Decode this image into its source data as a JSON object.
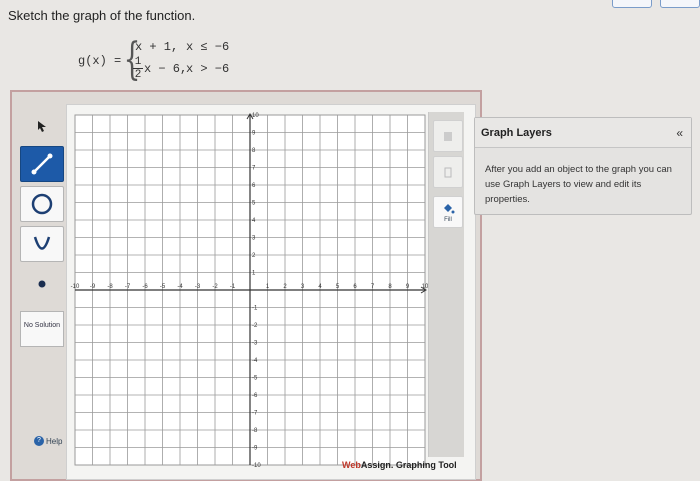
{
  "instruction": "Sketch the graph of the function.",
  "function": {
    "name": "g(x) =",
    "piece1_expr": "x + 1,",
    "piece1_cond": "x ≤ −6",
    "piece2_frac_num": "1",
    "piece2_frac_den": "2",
    "piece2_expr": "x − 6,",
    "piece2_cond": "x > −6"
  },
  "toolbar": {
    "no_solution_label": "No Solution",
    "help_label": "Help"
  },
  "graph": {
    "x_ticks": [
      "-10",
      "-9",
      "-8",
      "-7",
      "-6",
      "-5",
      "-4",
      "-3",
      "-2",
      "-1",
      "1",
      "2",
      "3",
      "4",
      "5",
      "6",
      "7",
      "8",
      "9",
      "10"
    ],
    "y_ticks": [
      "10",
      "9",
      "8",
      "7",
      "6",
      "5",
      "4",
      "3",
      "2",
      "1",
      "-1",
      "-2",
      "-3",
      "-4",
      "-5",
      "-6",
      "-7",
      "-8",
      "-9",
      "-10"
    ]
  },
  "right_tools": {
    "fill_label": "Fill"
  },
  "brand": {
    "web": "Web",
    "assign": "Assign.",
    "suffix": " Graphing Tool"
  },
  "layers": {
    "title": "Graph Layers",
    "collapse_glyph": "«",
    "body": "After you add an object to the graph you can use Graph Layers to view and edit its properties."
  },
  "colors": {
    "accent": "#1d5aa8",
    "grid": "#9a9a9a",
    "brand_red": "#c0392b"
  }
}
